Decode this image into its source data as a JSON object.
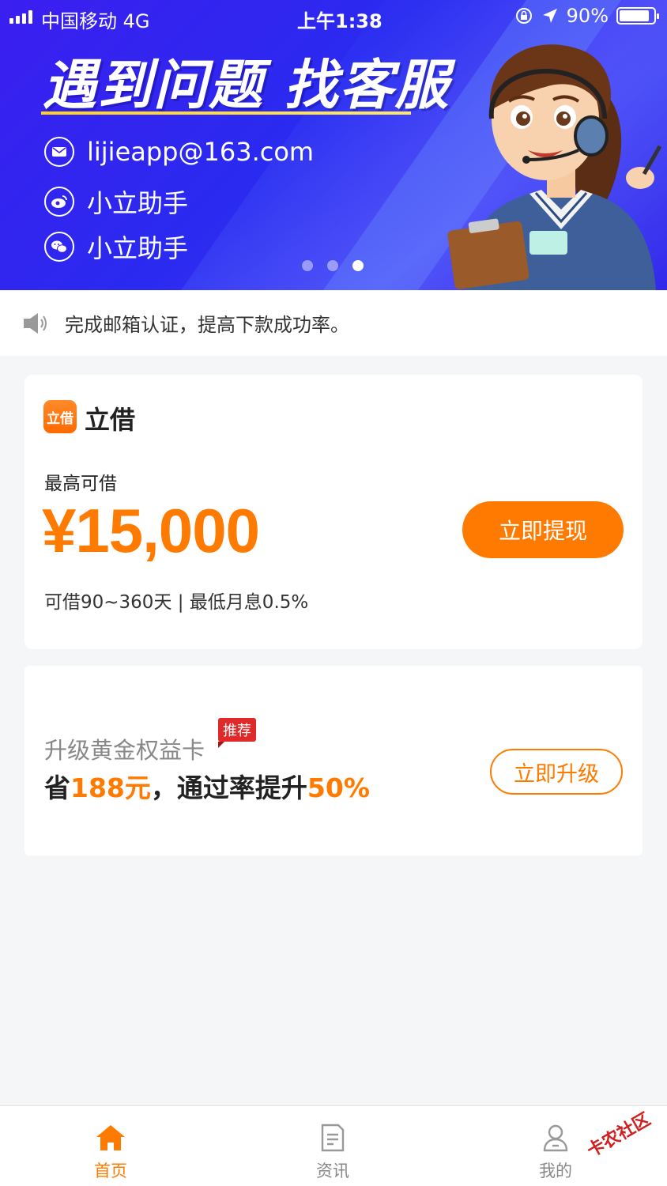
{
  "status_bar": {
    "carrier": "中国移动  4G",
    "time": "上午1:38",
    "battery": "90%",
    "battery_level": 0.9
  },
  "banner": {
    "title": "遇到问题 找客服",
    "contacts": [
      {
        "icon": "mail-icon",
        "label": "lijieapp@163.com"
      },
      {
        "icon": "weibo-icon",
        "label": "小立助手"
      },
      {
        "icon": "wechat-icon",
        "label": "小立助手"
      }
    ],
    "carousel_active_index": 2,
    "carousel_count": 3
  },
  "notice": {
    "icon": "speaker-icon",
    "text": "完成邮箱认证，提高下款成功率。"
  },
  "loan": {
    "app_logo_text": "立借",
    "app_name": "立借",
    "label": "最高可借",
    "amount": "¥15,000",
    "terms": "可借90~360天 | 最低月息0.5%",
    "button": "立即提现"
  },
  "upgrade": {
    "title": "升级黄金权益卡",
    "badge": "推荐",
    "desc_prefix": "省",
    "desc_save": "188元",
    "desc_middle": "，通过率提升",
    "desc_rate": "50%",
    "button": "立即升级"
  },
  "tabbar": {
    "items": [
      {
        "label": "首页",
        "icon": "home-icon",
        "active": true
      },
      {
        "label": "资讯",
        "icon": "news-icon",
        "active": false
      },
      {
        "label": "我的",
        "icon": "user-icon",
        "active": false
      }
    ]
  },
  "watermark": "卡农社区",
  "colors": {
    "accent": "#ff7a00",
    "banner_blue": "#3b1ff0",
    "badge_red": "#e02a2a"
  }
}
